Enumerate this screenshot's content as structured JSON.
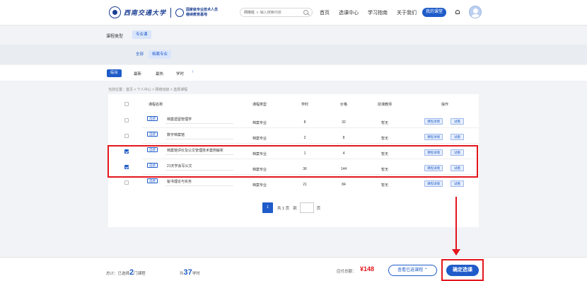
{
  "header": {
    "logo_name": "西南交通大学",
    "logo_sub_1": "国家级专业技术人员",
    "logo_sub_2": "继续教育基地",
    "search_scope": "网络班",
    "search_placeholder": "输入搜索内容",
    "nav": [
      "首页",
      "选课中心",
      "学习指南",
      "关于我们"
    ],
    "my_courses": "我的课堂"
  },
  "filters": {
    "type_label": "课程类型",
    "type_selected": "专业课",
    "major_all": "全部",
    "major_selected": "档案专业"
  },
  "sort": {
    "items": [
      "综合",
      "最新",
      "最热",
      "学时"
    ],
    "active": "综合",
    "arrow": "↑"
  },
  "breadcrumb": "当前位置：首页 > 个人中心 > 网络班级 > 选择课程",
  "table": {
    "headers": [
      "课程名称",
      "课程类型",
      "学时",
      "价格",
      "授课教师",
      "操作"
    ],
    "rows": [
      {
        "checked": false,
        "tag": "选修",
        "name": "档案遗留管理学",
        "type": "档案专业",
        "hours": "8",
        "price": "32",
        "teacher": "暂无",
        "detail": "课程详情",
        "try": "试看"
      },
      {
        "checked": false,
        "tag": "选修",
        "name": "数字档案馆",
        "type": "档案专业",
        "hours": "2",
        "price": "8",
        "teacher": "暂无",
        "detail": "课程详情",
        "try": "试看"
      },
      {
        "checked": true,
        "tag": "选修",
        "name": "档案馆评价及公文管理技术案例解析",
        "type": "档案专业",
        "hours": "1",
        "price": "4",
        "teacher": "暂无",
        "detail": "课程详情",
        "try": "试看"
      },
      {
        "checked": true,
        "tag": "选修",
        "name": "21天学会写公文",
        "type": "档案专业",
        "hours": "36",
        "price": "144",
        "teacher": "暂无",
        "detail": "课程详情",
        "try": "试看"
      },
      {
        "checked": false,
        "tag": "选修",
        "name": "秘书理论与实务",
        "type": "档案专业",
        "hours": "21",
        "price": "84",
        "teacher": "暂无",
        "detail": "课程详情",
        "try": "试看"
      }
    ]
  },
  "pager": {
    "current": "1",
    "total_text": "共 1 页",
    "goto": "到",
    "page_unit": "页"
  },
  "footer": {
    "total_label": "总计：已选择",
    "selected_count": "2",
    "course_unit": "门课程",
    "hours_prefix": "共",
    "total_hours": "37",
    "hours_unit": "学时",
    "amount_label": "应付总额：",
    "amount": "¥148",
    "view_selected": "查看已选课程",
    "view_chevron": "⌃",
    "confirm": "确定选课"
  },
  "colors": {
    "primary": "#1f5cc9",
    "highlight": "#e4161d"
  }
}
